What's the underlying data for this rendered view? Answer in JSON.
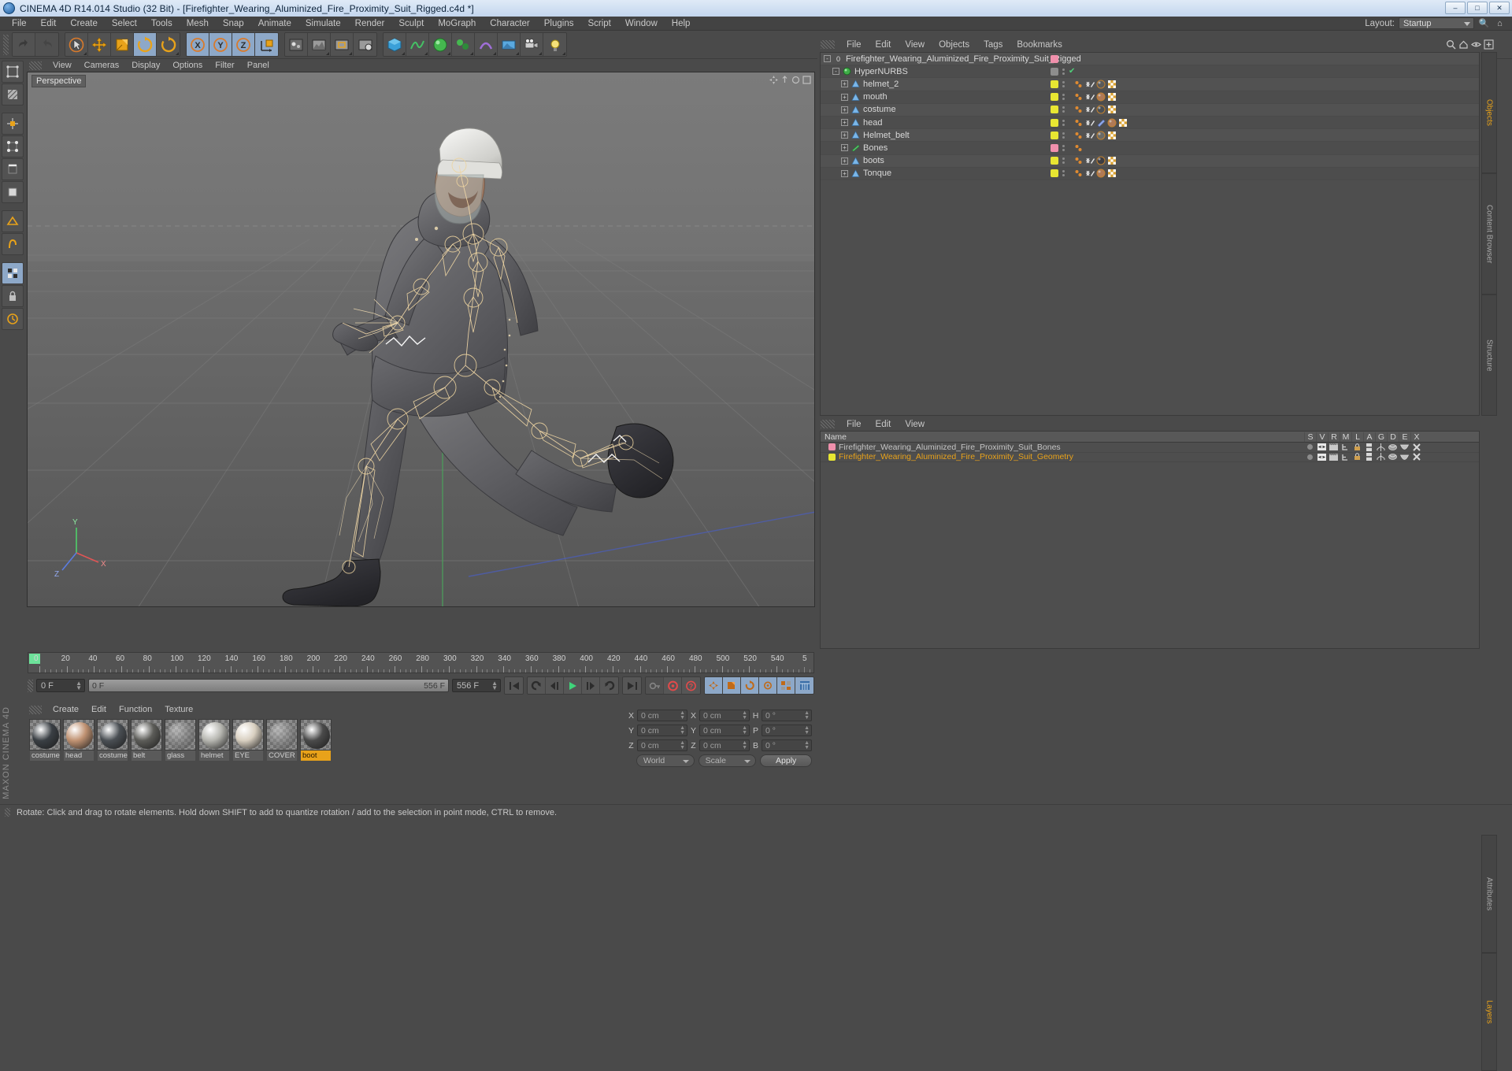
{
  "window": {
    "title": "CINEMA 4D R14.014 Studio (32 Bit) - [Firefighter_Wearing_Aluminized_Fire_Proximity_Suit_Rigged.c4d *]",
    "app_icon": "c4d-logo-icon",
    "minimize": "–",
    "maximize": "□",
    "close": "✕"
  },
  "menubar": {
    "items": [
      "File",
      "Edit",
      "Create",
      "Select",
      "Tools",
      "Mesh",
      "Snap",
      "Animate",
      "Simulate",
      "Render",
      "Sculpt",
      "MoGraph",
      "Character",
      "Plugins",
      "Script",
      "Window",
      "Help"
    ],
    "layout_label": "Layout:",
    "layout_value": "Startup",
    "search_icon": "search-icon"
  },
  "toolbar": {
    "groups": [
      {
        "name": "history",
        "buttons": [
          {
            "icon": "undo-icon",
            "label": "Undo",
            "state": "normal"
          },
          {
            "icon": "redo-icon",
            "label": "Redo",
            "state": "disabled"
          }
        ]
      },
      {
        "name": "tools",
        "buttons": [
          {
            "icon": "live-selection-icon",
            "label": "Live Selection",
            "state": "normal"
          },
          {
            "icon": "move-icon",
            "label": "Move",
            "state": "normal"
          },
          {
            "icon": "scale-icon",
            "label": "Scale",
            "state": "normal"
          },
          {
            "icon": "rotate-icon",
            "label": "Rotate",
            "state": "active"
          },
          {
            "icon": "rotate-alt-icon",
            "label": "Rotate Band",
            "state": "normal"
          }
        ]
      },
      {
        "name": "axis",
        "buttons": [
          {
            "icon": "axis-x-icon",
            "label": "X Axis",
            "state": "active"
          },
          {
            "icon": "axis-y-icon",
            "label": "Y Axis",
            "state": "active"
          },
          {
            "icon": "axis-z-icon",
            "label": "Z Axis",
            "state": "active"
          },
          {
            "icon": "world-object-axis-icon",
            "label": "World/Object",
            "state": "active"
          }
        ]
      },
      {
        "name": "primitives",
        "buttons": [
          {
            "icon": "cube-icon",
            "label": "Cube",
            "state": "normal"
          },
          {
            "icon": "spline-icon",
            "label": "Spline",
            "state": "normal"
          },
          {
            "icon": "nurbs-icon",
            "label": "HyperNURBS",
            "state": "normal"
          },
          {
            "icon": "array-icon",
            "label": "Array",
            "state": "normal"
          },
          {
            "icon": "scene-icon",
            "label": "Scene",
            "state": "normal"
          }
        ]
      },
      {
        "name": "render",
        "buttons": [
          {
            "icon": "render-view-icon",
            "label": "Render View",
            "state": "normal"
          },
          {
            "icon": "render-region-icon",
            "label": "Render Region",
            "state": "normal"
          },
          {
            "icon": "render-settings-icon",
            "label": "Render Settings",
            "state": "normal"
          }
        ]
      },
      {
        "name": "deform",
        "buttons": [
          {
            "icon": "cube-obj-icon",
            "label": "Cube Object",
            "state": "normal"
          },
          {
            "icon": "sweep-icon",
            "label": "Sweep NURBS",
            "state": "normal"
          },
          {
            "icon": "mograph-icon",
            "label": "MoGraph",
            "state": "normal"
          },
          {
            "icon": "deformer-icon",
            "label": "Deformer",
            "state": "normal"
          },
          {
            "icon": "environment-icon",
            "label": "Environment",
            "state": "normal"
          },
          {
            "icon": "camera-icon",
            "label": "Camera",
            "state": "normal"
          },
          {
            "icon": "light-icon",
            "label": "Light",
            "state": "normal"
          }
        ]
      }
    ]
  },
  "left_tools": [
    {
      "icon": "model-mode-icon",
      "label": "Model Mode",
      "state": "normal"
    },
    {
      "icon": "texture-mode-icon",
      "label": "Texture Mode",
      "state": "normal"
    },
    {
      "icon": "object-axis-icon",
      "label": "Object Axis",
      "state": "normal"
    },
    {
      "icon": "points-mode-icon",
      "label": "Points Mode",
      "state": "normal"
    },
    {
      "icon": "edges-mode-icon",
      "label": "Edges Mode",
      "state": "normal"
    },
    {
      "icon": "polygons-mode-icon",
      "label": "Polygons Mode",
      "state": "normal"
    },
    {
      "icon": "workplane-icon",
      "label": "Workplane",
      "state": "normal"
    },
    {
      "icon": "snap-icon",
      "label": "Enable Snap",
      "state": "normal"
    },
    {
      "icon": "viewport-solo-icon",
      "label": "Viewport Solo",
      "state": "active"
    },
    {
      "icon": "lock-icon",
      "label": "Lock Axis",
      "state": "normal"
    },
    {
      "icon": "animate-mode-icon",
      "label": "Animate Mode",
      "state": "normal"
    }
  ],
  "brand": "MAXON CINEMA 4D",
  "viewport": {
    "menu": [
      "View",
      "Cameras",
      "Display",
      "Options",
      "Filter",
      "Panel"
    ],
    "label": "Perspective",
    "axis_y": "Y",
    "axis_x": "X",
    "axis_z": "Z"
  },
  "timeline": {
    "ticks": [
      0,
      20,
      40,
      60,
      80,
      100,
      120,
      140,
      160,
      180,
      200,
      220,
      240,
      260,
      280,
      300,
      320,
      340,
      360,
      380,
      400,
      420,
      440,
      460,
      480,
      500,
      520,
      540
    ],
    "tick_end_label": "5",
    "current_frame_label": "0 F",
    "current_frame_field": "0 F",
    "scrub_left": "0 F",
    "scrub_right": "556 F",
    "end_frame_field": "556 F",
    "controls": [
      {
        "icon": "go-to-start-icon",
        "label": "Go To Start",
        "state": "normal"
      },
      {
        "icon": "play-backward-loop-icon",
        "label": "Play Backwards",
        "state": "normal"
      },
      {
        "icon": "step-back-icon",
        "label": "Step Back",
        "state": "normal"
      },
      {
        "icon": "play-forward-icon",
        "label": "Play Forwards",
        "state": "normal"
      },
      {
        "icon": "step-forward-icon",
        "label": "Step Forward",
        "state": "normal"
      },
      {
        "icon": "loop-icon",
        "label": "Loop",
        "state": "normal"
      },
      {
        "icon": "go-to-end-icon",
        "label": "Go To End",
        "state": "normal"
      },
      {
        "icon": "autokey-icon",
        "label": "Autokeying",
        "state": "disabled"
      },
      {
        "icon": "record-icon",
        "label": "Record Active Objects",
        "state": "normal"
      },
      {
        "icon": "question-icon",
        "label": "Keyframe Selection",
        "state": "normal"
      },
      {
        "icon": "key-position-icon",
        "label": "Position",
        "state": "active"
      },
      {
        "icon": "key-scale-icon",
        "label": "Scale",
        "state": "active"
      },
      {
        "icon": "key-rotation-icon",
        "label": "Rotation",
        "state": "active"
      },
      {
        "icon": "key-param-icon",
        "label": "Parameter",
        "state": "active"
      },
      {
        "icon": "key-pla-icon",
        "label": "Point Level Animation",
        "state": "active"
      },
      {
        "icon": "timeline-icon",
        "label": "Timeline",
        "state": "active"
      }
    ]
  },
  "materials": {
    "menu": [
      "Create",
      "Edit",
      "Function",
      "Texture"
    ],
    "items": [
      {
        "name": "costume",
        "color": "#3a3f44",
        "selected": false
      },
      {
        "name": "head",
        "color": "#c09272",
        "selected": false
      },
      {
        "name": "costume",
        "color": "#4a4f54",
        "selected": false
      },
      {
        "name": "belt",
        "color": "#5c5c58",
        "selected": false
      },
      {
        "name": "glass",
        "color": "#9a9a9a",
        "selected": false
      },
      {
        "name": "helmet",
        "color": "#b6b6b0",
        "selected": false
      },
      {
        "name": "EYE",
        "color": "#d8cfc0",
        "selected": false
      },
      {
        "name": "COVER",
        "color": "#9d9d9d",
        "selected": false
      },
      {
        "name": "boot",
        "color": "#4a4a4a",
        "selected": true
      }
    ]
  },
  "coordinates": {
    "position": {
      "label_x": "X",
      "label_y": "Y",
      "label_z": "Z",
      "x": "0 cm",
      "y": "0 cm",
      "z": "0 cm"
    },
    "size": {
      "label_x": "X",
      "label_y": "Y",
      "label_z": "Z",
      "x": "0 cm",
      "y": "0 cm",
      "z": "0 cm"
    },
    "rotation": {
      "label_h": "H",
      "label_p": "P",
      "label_b": "B",
      "h": "0 °",
      "p": "0 °",
      "b": "0 °"
    },
    "coord_system": "World",
    "size_mode": "Scale",
    "apply_label": "Apply"
  },
  "object_manager": {
    "menu": [
      "File",
      "Edit",
      "View",
      "Objects",
      "Tags",
      "Bookmarks"
    ],
    "header_icons": [
      "search-icon",
      "home-icon",
      "eye-icon",
      "add-icon"
    ],
    "rows": [
      {
        "name": "Firefighter_Wearing_Aluminized_Fire_Proximity_Suit_Rigged",
        "indent": 0,
        "icon": "null-object-icon",
        "layer_color": "#f090ac",
        "expander": "-",
        "tags": [],
        "check": false
      },
      {
        "name": "HyperNURBS",
        "indent": 1,
        "icon": "hypernurbs-icon",
        "layer_color": "#8d8d8d",
        "expander": "-",
        "tags": [],
        "check": true
      },
      {
        "name": "helmet_2",
        "indent": 2,
        "icon": "polygon-object-icon",
        "layer_color": "#e8e632",
        "expander": "+",
        "tags": [
          "point-tag",
          "weight-tag",
          "material-helmet",
          "uvw-tag"
        ],
        "check": false
      },
      {
        "name": "mouth",
        "indent": 2,
        "icon": "polygon-object-icon",
        "layer_color": "#e8e632",
        "expander": "+",
        "tags": [
          "point-tag",
          "weight-tag",
          "material-head",
          "uvw-tag"
        ],
        "check": false
      },
      {
        "name": "costume",
        "indent": 2,
        "icon": "polygon-object-icon",
        "layer_color": "#e8e632",
        "expander": "+",
        "tags": [
          "point-tag",
          "weight-tag",
          "material-costume",
          "uvw-tag"
        ],
        "check": false
      },
      {
        "name": "head",
        "indent": 2,
        "icon": "polygon-object-icon",
        "layer_color": "#e8e632",
        "expander": "+",
        "tags": [
          "point-tag",
          "weight-tag",
          "bone-tag",
          "material-head",
          "uvw-tag"
        ],
        "check": false
      },
      {
        "name": "Helmet_belt",
        "indent": 2,
        "icon": "polygon-object-icon",
        "layer_color": "#e8e632",
        "expander": "+",
        "tags": [
          "point-tag",
          "weight-tag",
          "material-belt",
          "uvw-tag"
        ],
        "check": false
      },
      {
        "name": "Bones",
        "indent": 2,
        "icon": "bone-icon",
        "layer_color": "#f090ac",
        "expander": "+",
        "tags": [
          "point-tag"
        ],
        "check": false
      },
      {
        "name": "boots",
        "indent": 2,
        "icon": "polygon-object-icon",
        "layer_color": "#e8e632",
        "expander": "+",
        "tags": [
          "point-tag",
          "weight-tag",
          "material-boot",
          "uvw-tag"
        ],
        "check": false
      },
      {
        "name": "Tonque",
        "indent": 2,
        "icon": "polygon-object-icon",
        "layer_color": "#e8e632",
        "expander": "+",
        "tags": [
          "point-tag",
          "weight-tag",
          "material-head",
          "uvw-tag"
        ],
        "check": false
      }
    ],
    "side_tabs": [
      {
        "label": "Objects",
        "active": true
      },
      {
        "label": "Content Browser",
        "active": false
      },
      {
        "label": "Structure",
        "active": false
      }
    ]
  },
  "layer_manager": {
    "menu": [
      "File",
      "Edit",
      "View"
    ],
    "columns": [
      "Name",
      "S",
      "V",
      "R",
      "M",
      "L",
      "A",
      "G",
      "D",
      "E",
      "X"
    ],
    "rows": [
      {
        "name": "Firefighter_Wearing_Aluminized_Fire_Proximity_Suit_Bones",
        "color": "#f090ac",
        "selected": false
      },
      {
        "name": "Firefighter_Wearing_Aluminized_Fire_Proximity_Suit_Geometry",
        "color": "#e8e632",
        "selected": true
      }
    ],
    "side_tabs": [
      {
        "label": "Attributes",
        "active": false
      },
      {
        "label": "Layers",
        "active": true
      }
    ]
  },
  "statusbar": {
    "message": "Rotate: Click and drag to rotate elements. Hold down SHIFT to add to quantize rotation / add to the selection in point mode, CTRL to remove."
  },
  "colors": {
    "accent_orange": "#e8a21a",
    "layer_pink": "#f090ac",
    "layer_yellow": "#e8e632",
    "play_green": "#3fd47a",
    "panel_bg": "#4a4a4a",
    "title_blue": "#c3d6ee"
  }
}
